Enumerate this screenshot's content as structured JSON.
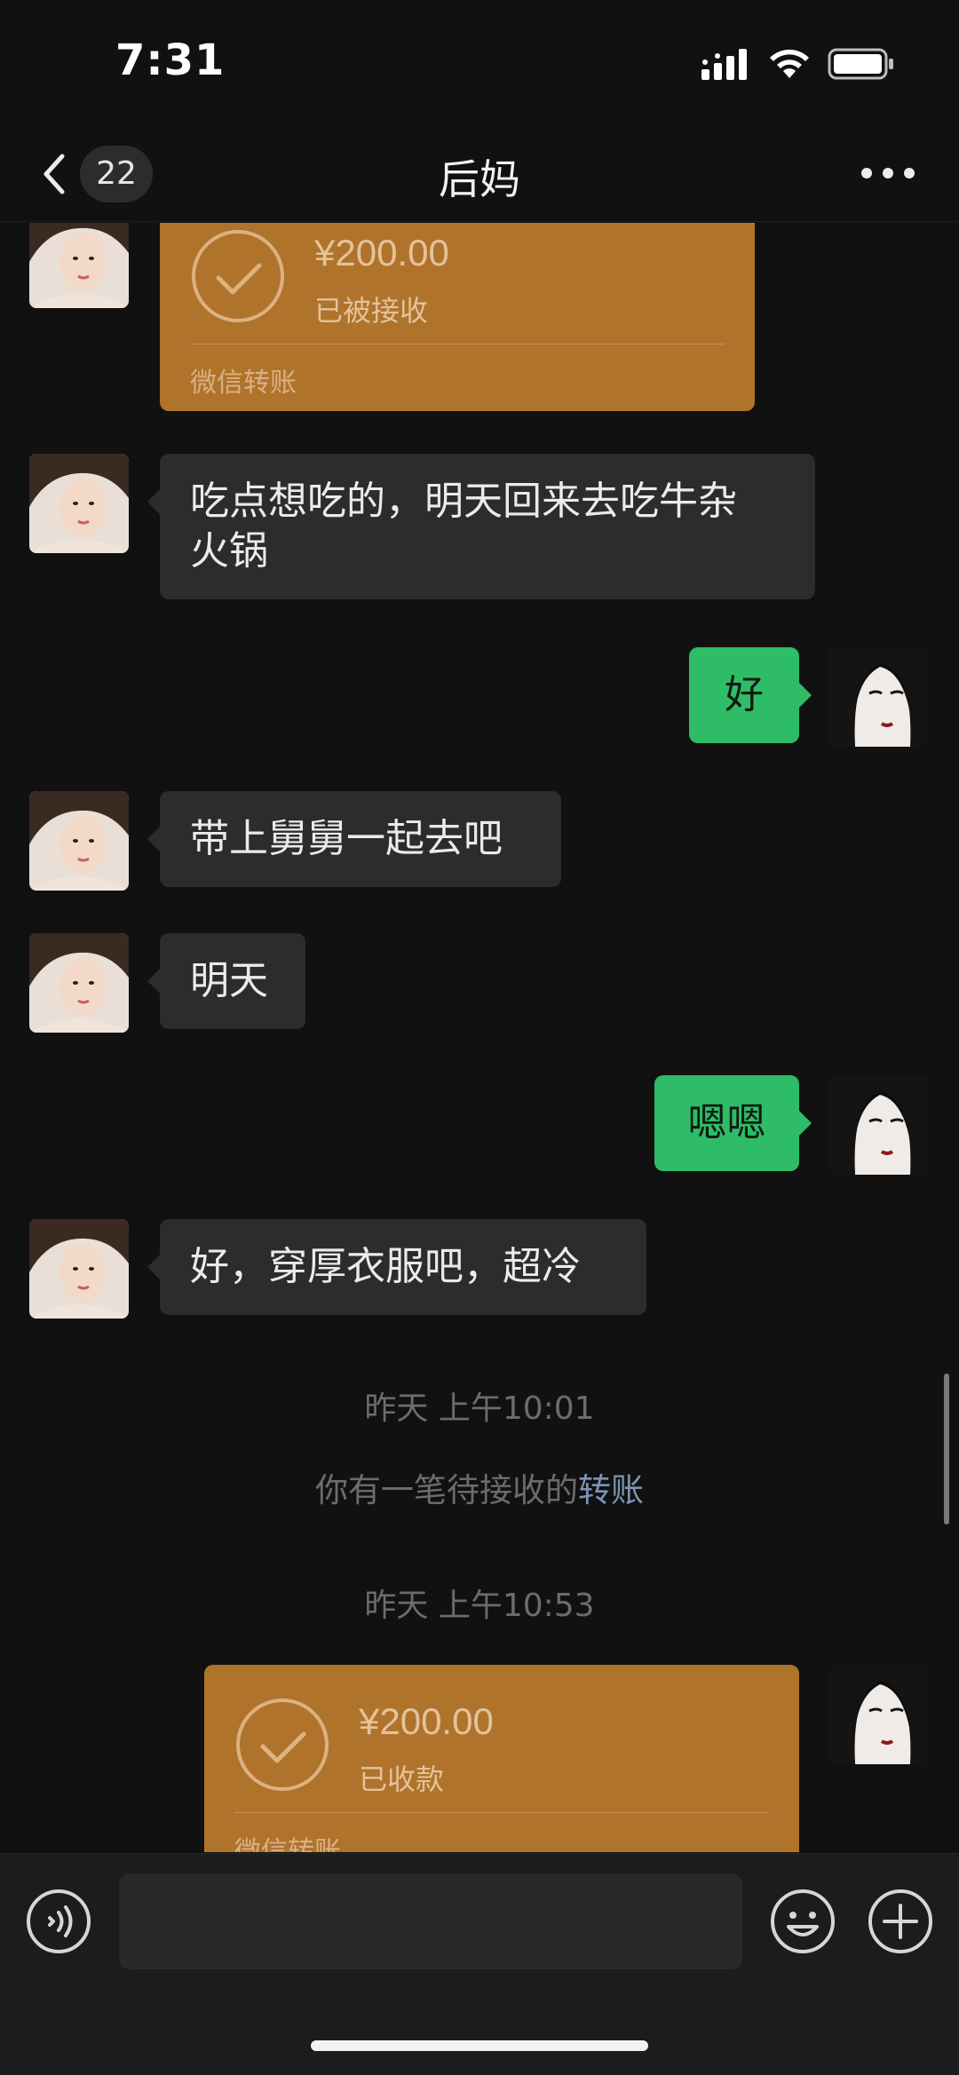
{
  "status_bar": {
    "time": "7:31"
  },
  "header": {
    "back_badge": "22",
    "title": "后妈"
  },
  "messages": {
    "m1": {
      "amount": "¥200.00",
      "status": "已被接收",
      "label": "微信转账"
    },
    "m2": {
      "line1": "吃点想吃的，明天回来去吃牛杂",
      "line2": "火锅"
    },
    "m3": {
      "text": "好"
    },
    "m4": {
      "text": "带上舅舅一起去吧"
    },
    "m5": {
      "text": "明天"
    },
    "m6": {
      "text": "嗯嗯"
    },
    "m7": {
      "text": "好，穿厚衣服吧，超冷"
    },
    "t1": {
      "text": "昨天 上午10:01"
    },
    "notice": {
      "prefix": "你有一笔待接收的",
      "link": "转账"
    },
    "t2": {
      "text": "昨天 上午10:53"
    },
    "m8": {
      "amount": "¥200.00",
      "status": "已收款",
      "label": "微信转账"
    }
  },
  "input": {
    "placeholder": ""
  },
  "colors": {
    "background": "#111111",
    "incoming_bubble": "#2c2c2c",
    "outgoing_bubble": "#2ebd66",
    "transfer_card": "#b0732c",
    "link": "#7e93b4"
  },
  "icons": {
    "back": "chevron-left-icon",
    "more": "more-dots-icon",
    "voice": "voice-icon",
    "emoji": "emoji-icon",
    "plus": "plus-icon",
    "transfer": "check-circle-icon"
  }
}
